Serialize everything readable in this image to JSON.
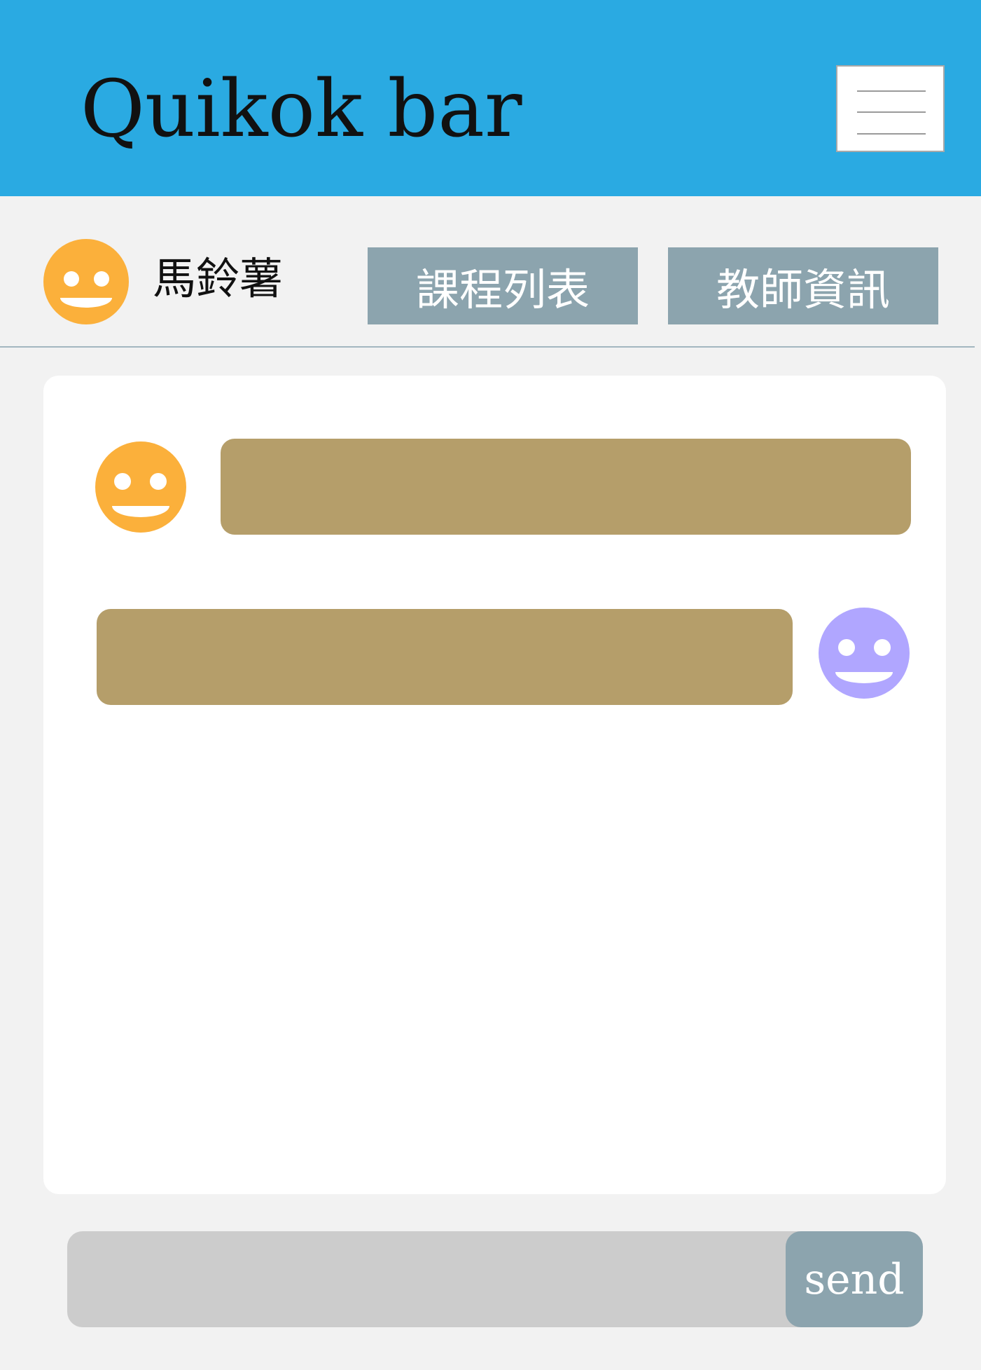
{
  "header": {
    "title": "Quikok bar",
    "menu_icon": "hamburger-menu-icon"
  },
  "user": {
    "name": "馬鈴薯",
    "avatar_icon": "smiley-face-icon",
    "avatar_color": "#fbb03b"
  },
  "nav": {
    "courses_label": "課程列表",
    "teachers_label": "教師資訊"
  },
  "chat": {
    "messages": [
      {
        "sender": "self",
        "text": "",
        "avatar_color": "#fbb03b"
      },
      {
        "sender": "other",
        "text": "",
        "avatar_color": "#b0a6ff"
      }
    ]
  },
  "composer": {
    "input_value": "",
    "placeholder": "",
    "send_label": "send"
  },
  "colors": {
    "header_bg": "#2aaae2",
    "button_bg": "#8ca4ae",
    "bubble_bg": "#b59e6a",
    "page_bg": "#f2f2f2"
  }
}
